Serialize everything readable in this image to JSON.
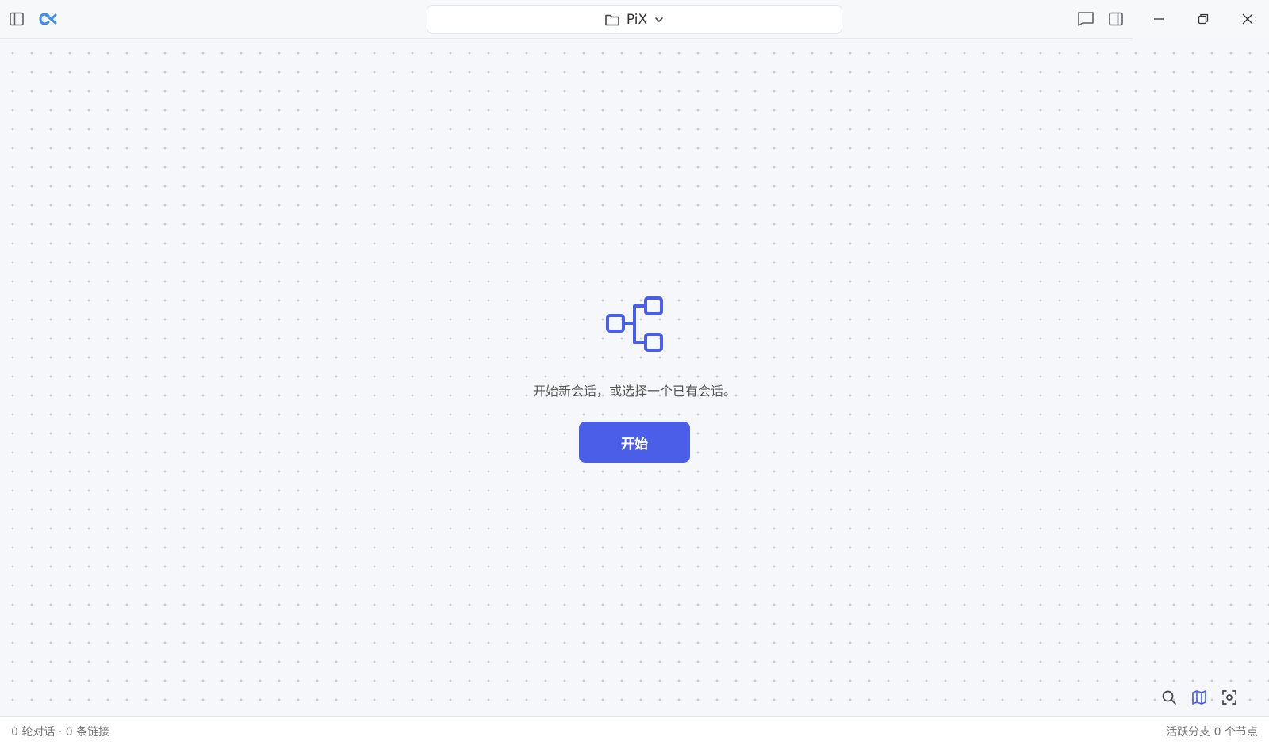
{
  "header": {
    "project_name": "PiX",
    "icons": {
      "sidebar_toggle": "sidebar-toggle-icon",
      "logo": "app-logo-icon",
      "folder": "folder-icon",
      "chevron": "chevron-down-icon",
      "chat": "chat-icon",
      "panel": "right-panel-icon",
      "minimize": "minimize-icon",
      "restore": "restore-icon",
      "close": "close-icon"
    }
  },
  "canvas": {
    "empty_message": "开始新会话，或选择一个已有会话。",
    "start_label": "开始",
    "tools": [
      "search-icon",
      "map-icon",
      "fit-view-icon"
    ]
  },
  "status": {
    "left": "0 轮对话 · 0 条链接",
    "right": "活跃分支 0 个节点"
  },
  "colors": {
    "accent": "#4b5ee8",
    "logo": "#3b8fe6",
    "background": "#f6f7fa"
  }
}
